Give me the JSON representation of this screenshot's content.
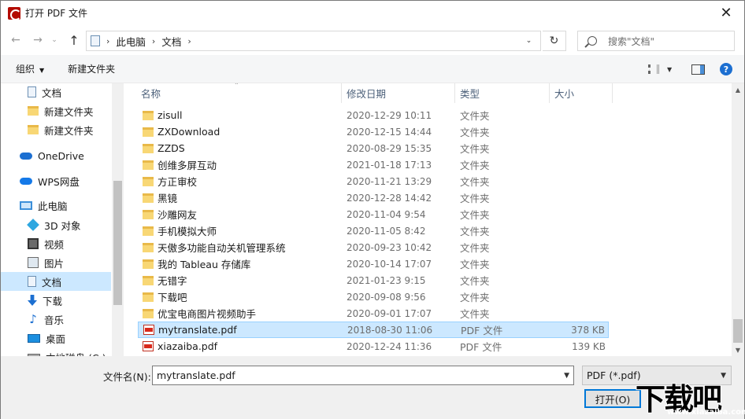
{
  "window": {
    "title": "打开 PDF 文件",
    "close_glyph": "✕"
  },
  "nav": {
    "back_glyph": "←",
    "forward_glyph": "→",
    "recent_glyph": "⌄",
    "up_glyph": "↑",
    "breadcrumbs": [
      "此电脑",
      "文档"
    ],
    "refresh_glyph": "↻",
    "search_placeholder": "搜索\"文档\""
  },
  "toolbar": {
    "organize": "组织",
    "new_folder": "新建文件夹",
    "help": "?"
  },
  "sidebar": {
    "items": [
      {
        "label": "文档",
        "icon": "document-icon",
        "selected": false
      },
      {
        "label": "新建文件夹",
        "icon": "folder-icon",
        "selected": false
      },
      {
        "label": "新建文件夹",
        "icon": "folder-icon",
        "selected": false
      },
      {
        "label": "OneDrive",
        "icon": "onedrive-cloud-icon",
        "selected": false
      },
      {
        "label": "WPS网盘",
        "icon": "wps-cloud-icon",
        "selected": false
      },
      {
        "label": "此电脑",
        "icon": "computer-icon",
        "selected": false
      },
      {
        "label": "3D 对象",
        "icon": "3d-objects-icon",
        "selected": false
      },
      {
        "label": "视频",
        "icon": "video-icon",
        "selected": false
      },
      {
        "label": "图片",
        "icon": "pictures-icon",
        "selected": false
      },
      {
        "label": "文档",
        "icon": "document-icon",
        "selected": true
      },
      {
        "label": "下载",
        "icon": "download-icon",
        "selected": false
      },
      {
        "label": "音乐",
        "icon": "music-icon",
        "selected": false
      },
      {
        "label": "桌面",
        "icon": "desktop-icon",
        "selected": false
      },
      {
        "label": "本地磁盘 (C:)",
        "icon": "drive-icon",
        "selected": false
      }
    ]
  },
  "columns": {
    "name": "名称",
    "date": "修改日期",
    "type": "类型",
    "size": "大小"
  },
  "files": [
    {
      "name": "zisull",
      "date": "2020-12-29 10:11",
      "type": "文件夹",
      "size": "",
      "kind": "folder",
      "selected": false
    },
    {
      "name": "ZXDownload",
      "date": "2020-12-15 14:44",
      "type": "文件夹",
      "size": "",
      "kind": "folder",
      "selected": false
    },
    {
      "name": "ZZDS",
      "date": "2020-08-29 15:35",
      "type": "文件夹",
      "size": "",
      "kind": "folder",
      "selected": false
    },
    {
      "name": "创维多屏互动",
      "date": "2021-01-18 17:13",
      "type": "文件夹",
      "size": "",
      "kind": "folder",
      "selected": false
    },
    {
      "name": "方正审校",
      "date": "2020-11-21 13:29",
      "type": "文件夹",
      "size": "",
      "kind": "folder",
      "selected": false
    },
    {
      "name": "黑镜",
      "date": "2020-12-28 14:42",
      "type": "文件夹",
      "size": "",
      "kind": "folder",
      "selected": false
    },
    {
      "name": "沙雕网友",
      "date": "2020-11-04 9:54",
      "type": "文件夹",
      "size": "",
      "kind": "folder",
      "selected": false
    },
    {
      "name": "手机模拟大师",
      "date": "2020-11-05 8:42",
      "type": "文件夹",
      "size": "",
      "kind": "folder",
      "selected": false
    },
    {
      "name": "天傲多功能自动关机管理系统",
      "date": "2020-09-23 10:42",
      "type": "文件夹",
      "size": "",
      "kind": "folder",
      "selected": false
    },
    {
      "name": "我的 Tableau 存储库",
      "date": "2020-10-14 17:07",
      "type": "文件夹",
      "size": "",
      "kind": "folder",
      "selected": false
    },
    {
      "name": "无错字",
      "date": "2021-01-23 9:15",
      "type": "文件夹",
      "size": "",
      "kind": "folder",
      "selected": false
    },
    {
      "name": "下载吧",
      "date": "2020-09-08 9:56",
      "type": "文件夹",
      "size": "",
      "kind": "folder",
      "selected": false
    },
    {
      "name": "优宝电商图片视频助手",
      "date": "2020-09-01 17:07",
      "type": "文件夹",
      "size": "",
      "kind": "folder",
      "selected": false
    },
    {
      "name": "mytranslate.pdf",
      "date": "2018-08-30 11:06",
      "type": "PDF 文件",
      "size": "378 KB",
      "kind": "pdf",
      "selected": true
    },
    {
      "name": "xiazaiba.pdf",
      "date": "2020-12-24 11:36",
      "type": "PDF 文件",
      "size": "139 KB",
      "kind": "pdf",
      "selected": false
    }
  ],
  "bottom": {
    "filename_label": "文件名(N):",
    "filename_value": "mytranslate.pdf",
    "filetype_value": "PDF (*.pdf)",
    "open_button": "打开(O)"
  },
  "watermark": {
    "text": "下载吧",
    "url": "www.xiazaiba.com"
  }
}
